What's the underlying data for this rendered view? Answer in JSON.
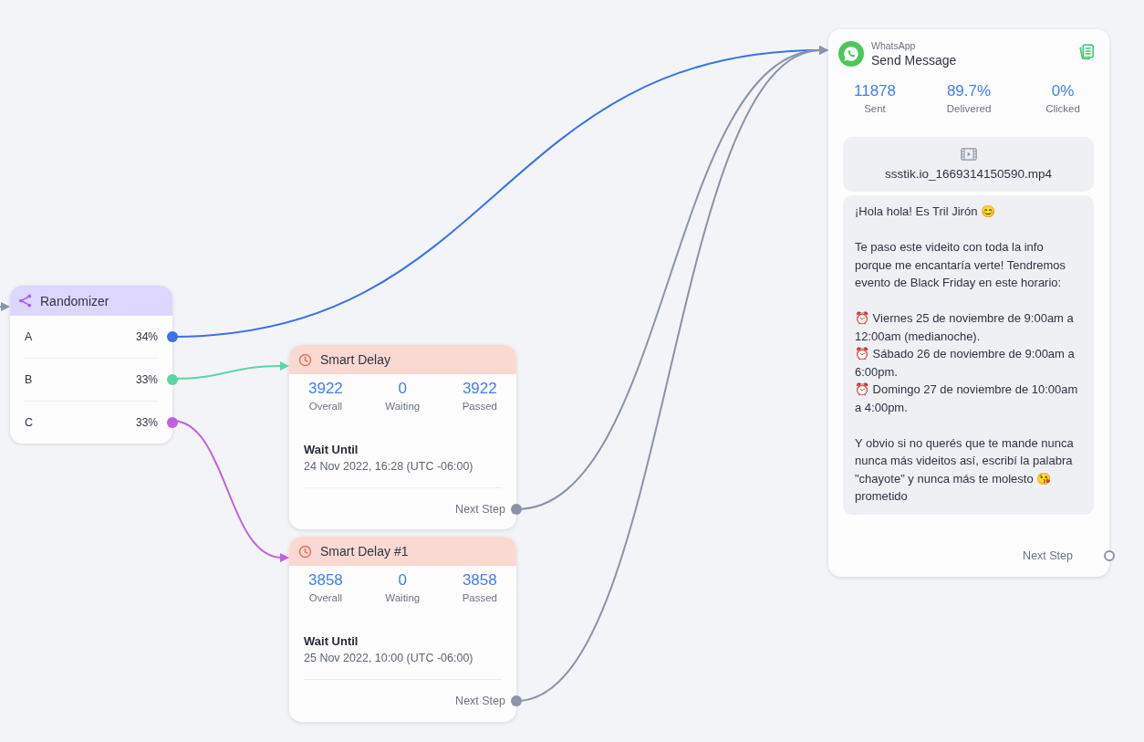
{
  "nodes": [
    {
      "kind": "randomizer",
      "title": "Randomizer",
      "branches": [
        {
          "label": "A",
          "percent": "34%",
          "color": "#3b72e4"
        },
        {
          "label": "B",
          "percent": "33%",
          "color": "#5bd6a6"
        },
        {
          "label": "C",
          "percent": "33%",
          "color": "#c25ee0"
        }
      ]
    },
    {
      "kind": "delay",
      "title": "Smart Delay",
      "stats": [
        {
          "value": "3922",
          "label": "Overall"
        },
        {
          "value": "0",
          "label": "Waiting"
        },
        {
          "value": "3922",
          "label": "Passed"
        }
      ],
      "wait_label": "Wait Until",
      "wait_time": "24 Nov 2022, 16:28 (UTC -06:00)",
      "next_label": "Next Step",
      "next_connected": true
    },
    {
      "kind": "delay",
      "title": "Smart Delay #1",
      "stats": [
        {
          "value": "3858",
          "label": "Overall"
        },
        {
          "value": "0",
          "label": "Waiting"
        },
        {
          "value": "3858",
          "label": "Passed"
        }
      ],
      "wait_label": "Wait Until",
      "wait_time": "25 Nov 2022, 10:00 (UTC -06:00)",
      "next_label": "Next Step",
      "next_connected": true
    },
    {
      "kind": "message",
      "channel": "WhatsApp",
      "title": "Send Message",
      "stats": [
        {
          "value": "11878",
          "label": "Sent"
        },
        {
          "value": "89.7%",
          "label": "Delivered"
        },
        {
          "value": "0%",
          "label": "Clicked"
        }
      ],
      "attachment": "ssstik.io_1669314150590.mp4",
      "text": "¡Hola hola! Es Tril Jirón 😊\n\nTe paso este videito con toda la info porque me encantaría verte! Tendremos evento de Black Friday en este horario:\n\n⏰ Viernes 25 de noviembre de 9:00am a 12:00am (medianoche).\n⏰ Sábado 26 de noviembre de 9:00am a 6:00pm.\n⏰ Domingo 27 de noviembre de 10:00am a 4:00pm.\n\nY obvio si no querés que te mande nunca nunca más videitos así, escribí la palabra \"chayote\" y nunca más te molesto 😘 prometido",
      "next_label": "Next Step",
      "next_connected": false
    }
  ]
}
